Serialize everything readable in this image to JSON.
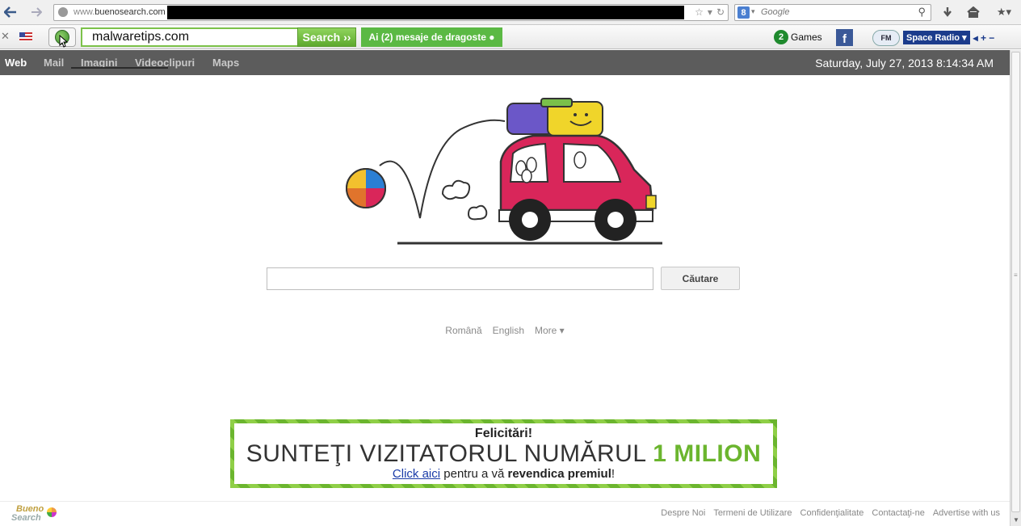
{
  "browser": {
    "url_prefix": "www.",
    "url_domain": "buenosearch.com",
    "search_placeholder": "Google",
    "search_engine_badge": "8"
  },
  "toolbar": {
    "query": "malwaretips.com",
    "search_label": "Search ››",
    "promo_label": "Ai (2) mesaje de dragoste ●",
    "games_badge": "2",
    "games_label": "Games",
    "facebook_label": "f",
    "radio_badge": "FM",
    "radio_label": "Space Radio ▾",
    "radio_controls": "◂ + −"
  },
  "nav": {
    "items": [
      "Web",
      "Mail",
      "Imagini",
      "Videoclipuri",
      "Maps"
    ],
    "datetime": "Saturday, July 27, 2013 8:14:34 AM"
  },
  "main": {
    "search_button": "Căutare",
    "languages": [
      "Română",
      "English",
      "More ▾"
    ]
  },
  "banner": {
    "line1": "Felicitări!",
    "line2_prefix": "SUNTEŢI VIZITATORUL NUMĂRUL ",
    "line2_highlight": "1 MILION",
    "line3_link": "Click aici",
    "line3_mid": " pentru a vă ",
    "line3_bold": "revendica premiul",
    "line3_end": "!"
  },
  "footer": {
    "logo_line1": "Bueno",
    "logo_line2": "Search",
    "links": [
      "Despre Noi",
      "Termeni de Utilizare",
      "Confidenţialitate",
      "Contactaţi-ne",
      "Advertise with us"
    ]
  },
  "colors": {
    "accent_green": "#6bb52e",
    "nav_bg": "#5c5c5c",
    "car_red": "#d9265a"
  },
  "icons": [
    "back-icon",
    "forward-icon",
    "globe-icon",
    "star-icon",
    "reload-icon",
    "search-icon",
    "download-icon",
    "home-icon",
    "bookmark-icon"
  ]
}
